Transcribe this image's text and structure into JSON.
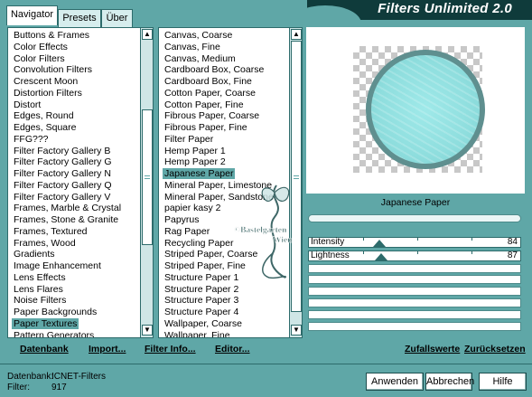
{
  "tabs": [
    {
      "label": "Navigator",
      "active": true
    },
    {
      "label": "Presets",
      "active": false
    },
    {
      "label": "Über",
      "active": false
    }
  ],
  "app_title": "Filters Unlimited 2.0",
  "categories": {
    "items": [
      "Buttons & Frames",
      "Color Effects",
      "Color Filters",
      "Convolution Filters",
      "Crescent Moon",
      "Distortion Filters",
      "Distort",
      "Edges, Round",
      "Edges, Square",
      "FFG???",
      "Filter Factory Gallery B",
      "Filter Factory Gallery G",
      "Filter Factory Gallery N",
      "Filter Factory Gallery Q",
      "Filter Factory Gallery V",
      "Frames, Marble & Crystal",
      "Frames, Stone & Granite",
      "Frames, Textured",
      "Frames, Wood",
      "Gradients",
      "Image Enhancement",
      "Lens Effects",
      "Lens Flares",
      "Noise Filters",
      "Paper Backgrounds",
      "Paper Textures",
      "Pattern Generators"
    ],
    "selected": "Paper Textures"
  },
  "filters": {
    "items": [
      "Canvas, Coarse",
      "Canvas, Fine",
      "Canvas, Medium",
      "Cardboard Box, Coarse",
      "Cardboard Box, Fine",
      "Cotton Paper, Coarse",
      "Cotton Paper, Fine",
      "Fibrous Paper, Coarse",
      "Fibrous Paper, Fine",
      "Filter Paper",
      "Hemp Paper 1",
      "Hemp Paper 2",
      "Japanese Paper",
      "Mineral Paper, Limestone",
      "Mineral Paper, Sandstone",
      "papier kasy 2",
      "Papyrus",
      "Rag Paper",
      "Recycling Paper",
      "Striped Paper, Coarse",
      "Striped Paper, Fine",
      "Structure Paper 1",
      "Structure Paper 2",
      "Structure Paper 3",
      "Structure Paper 4",
      "Wallpaper, Coarse",
      "Wallpaper, Fine"
    ],
    "selected": "Japanese Paper"
  },
  "preview": {
    "filter_name": "Japanese Paper"
  },
  "sliders": [
    {
      "label": "Intensity",
      "value": "84",
      "fraction": 0.33
    },
    {
      "label": "Lightness",
      "value": "87",
      "fraction": 0.34
    }
  ],
  "watermark": {
    "line1": "©Bastelgarten",
    "line2": "Wien"
  },
  "actions": {
    "database": "Datenbank",
    "import": "Import...",
    "filter_info": "Filter Info...",
    "editor": "Editor...",
    "random": "Zufallswerte",
    "reset": "Zurücksetzen"
  },
  "status": {
    "database_label": "Datenbank:",
    "database_value": "ICNET-Filters",
    "filter_label": "Filter:",
    "filter_value": "917"
  },
  "buttons": {
    "apply": "Anwenden",
    "cancel": "Abbrechen",
    "help": "Hilfe"
  },
  "colors": {
    "accent": "#5fa7a7",
    "dark": "#0f3b3b",
    "selection": "#5fa7a7"
  }
}
